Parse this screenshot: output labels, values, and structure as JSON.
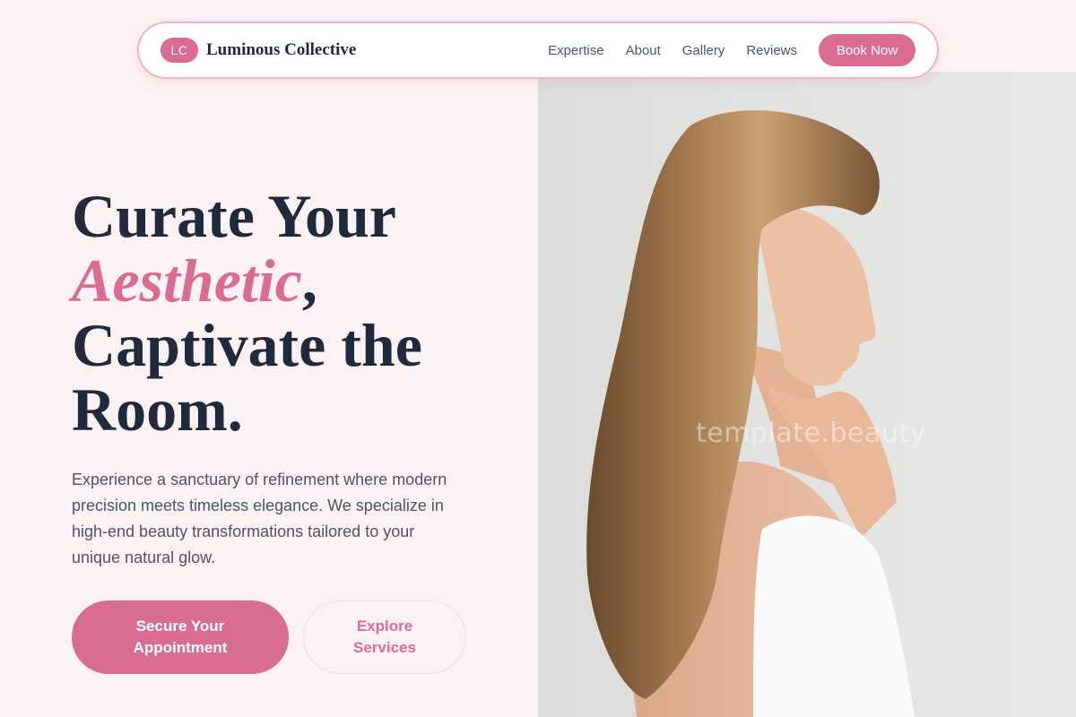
{
  "nav": {
    "logo_badge": "LC",
    "brand": "Luminous Collective",
    "links": [
      "Expertise",
      "About",
      "Gallery",
      "Reviews"
    ],
    "cta": "Book Now"
  },
  "hero": {
    "headline_line1": "Curate Your",
    "headline_accent": "Aesthetic",
    "headline_comma": ",",
    "headline_line3": "Captivate the",
    "headline_line4": "Room.",
    "description": "Experience a sanctuary of refinement where modern precision meets timeless elegance. We specialize in high-end beauty transformations tailored to your unique natural glow.",
    "primary_button": "Secure Your Appointment",
    "secondary_button": "Explore Services"
  },
  "photo": {
    "watermark": "template.beauty"
  },
  "colors": {
    "accent": "#d96c8f",
    "background": "#fdf2f3",
    "heading": "#1f2a3c"
  }
}
